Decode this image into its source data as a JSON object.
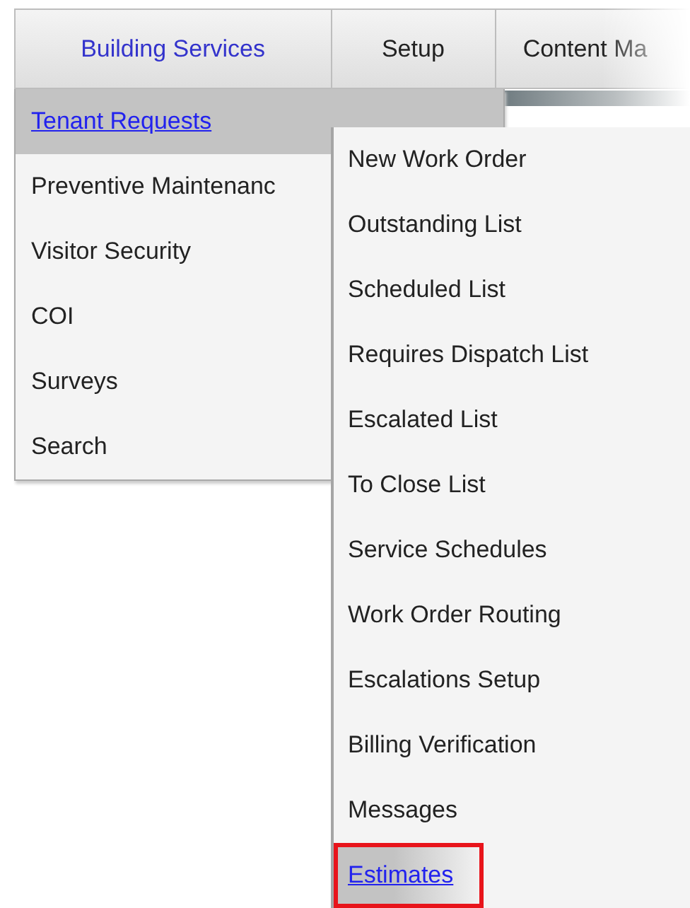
{
  "tabs": [
    {
      "label": "Building Services",
      "selected": true
    },
    {
      "label": "Setup",
      "selected": false
    },
    {
      "label": "Content Ma",
      "selected": false
    }
  ],
  "menu": {
    "items": [
      {
        "label": "Tenant Requests",
        "selected": true
      },
      {
        "label": "Preventive Maintenanc",
        "selected": false
      },
      {
        "label": "Visitor Security",
        "selected": false
      },
      {
        "label": "COI",
        "selected": false
      },
      {
        "label": "Surveys",
        "selected": false
      },
      {
        "label": "Search",
        "selected": false
      }
    ]
  },
  "submenu": {
    "items": [
      {
        "label": "New Work Order",
        "selected": false,
        "highlighted": false
      },
      {
        "label": "Outstanding List",
        "selected": false,
        "highlighted": false
      },
      {
        "label": "Scheduled List",
        "selected": false,
        "highlighted": false
      },
      {
        "label": "Requires Dispatch List",
        "selected": false,
        "highlighted": false
      },
      {
        "label": "Escalated List",
        "selected": false,
        "highlighted": false
      },
      {
        "label": "To Close List",
        "selected": false,
        "highlighted": false
      },
      {
        "label": "Service Schedules",
        "selected": false,
        "highlighted": false
      },
      {
        "label": "Work Order Routing",
        "selected": false,
        "highlighted": false
      },
      {
        "label": "Escalations Setup",
        "selected": false,
        "highlighted": false
      },
      {
        "label": "Billing Verification",
        "selected": false,
        "highlighted": false
      },
      {
        "label": "Messages",
        "selected": false,
        "highlighted": false
      },
      {
        "label": "Estimates",
        "selected": true,
        "highlighted": true
      }
    ]
  }
}
